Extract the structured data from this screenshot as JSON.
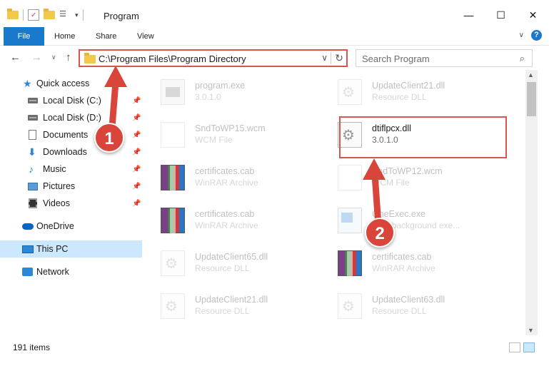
{
  "window": {
    "title": "Program",
    "minimize": "—",
    "maximize": "☐",
    "close": "✕"
  },
  "ribbon": {
    "tabs": [
      "File",
      "Home",
      "Share",
      "View"
    ],
    "expand": "∨",
    "help": "?"
  },
  "navigation": {
    "back": "←",
    "forward": "→",
    "recent": "∨",
    "up": "↑",
    "address": "C:\\Program Files\\Program Directory",
    "address_chevron": "∨",
    "refresh": "↻",
    "search_placeholder": "Search Program",
    "search_icon": "⌕"
  },
  "sidebar": {
    "items": [
      {
        "label": "Quick access",
        "icon": "star-icon"
      },
      {
        "label": "Local Disk (C:)",
        "icon": "disk-icon",
        "pinned": true
      },
      {
        "label": "Local Disk (D:)",
        "icon": "disk-icon",
        "pinned": true
      },
      {
        "label": "Documents",
        "icon": "documents-icon",
        "pinned": true
      },
      {
        "label": "Downloads",
        "icon": "download-icon",
        "pinned": true
      },
      {
        "label": "Music",
        "icon": "music-icon",
        "pinned": true
      },
      {
        "label": "Pictures",
        "icon": "pictures-icon",
        "pinned": true
      },
      {
        "label": "Videos",
        "icon": "videos-icon",
        "pinned": true
      },
      {
        "label": "OneDrive",
        "icon": "cloud-icon"
      },
      {
        "label": "This PC",
        "icon": "pc-icon",
        "selected": true
      },
      {
        "label": "Network",
        "icon": "network-icon"
      }
    ]
  },
  "files": {
    "left": [
      {
        "name": "program.exe",
        "type": "3.0.1.0",
        "icon": "exe"
      },
      {
        "name": "SndToWP15.wcm",
        "type": "WCM File",
        "icon": "wcm"
      },
      {
        "name": "certificates.cab",
        "type": "WinRAR Archive",
        "icon": "cab"
      },
      {
        "name": "certificates.cab",
        "type": "WinRAR Archive",
        "icon": "cab"
      },
      {
        "name": "UpdateClient65.dll",
        "type": "Resource DLL",
        "icon": "dll"
      },
      {
        "name": "UpdateClient21.dll",
        "type": "Resource DLL",
        "icon": "dll"
      }
    ],
    "right": [
      {
        "name": "UpdateClient21.dll",
        "type": "Resource DLL",
        "icon": "dll",
        "faded": true
      },
      {
        "name": "dtiflpcx.dll",
        "type": "3.0.1.0",
        "icon": "dll",
        "faded": false
      },
      {
        "name": "SndToWP12.wcm",
        "type": "WCM File",
        "icon": "wcm",
        "faded": true
      },
      {
        "name": "OneExec.exe",
        "type": "SDY background exe...",
        "icon": "oneexec",
        "faded": true
      },
      {
        "name": "certificates.cab",
        "type": "WinRAR Archive",
        "icon": "cab",
        "faded": true
      },
      {
        "name": "UpdateClient63.dll",
        "type": "Resource DLL",
        "icon": "dll",
        "faded": true
      }
    ]
  },
  "status": {
    "count": "191 items"
  },
  "annotations": {
    "step1": "1",
    "step2": "2",
    "color": "#d9443b"
  },
  "scroll": {
    "up": "▲",
    "down": "▼"
  }
}
